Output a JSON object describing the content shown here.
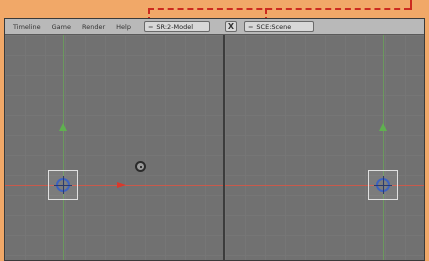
{
  "menubar": {
    "items": [
      "Timeline",
      "Game",
      "Render",
      "Help"
    ],
    "screen_prefix": "=",
    "screen_name": "SR:2-Model",
    "close_label": "X",
    "scene_prefix": "=",
    "scene_name": "SCE:Scene"
  },
  "icons": {
    "camera": "camera-icon",
    "origin": "object-origin-icon",
    "y_axis_arrow": "y-axis-arrow-icon",
    "x_axis_arrow": "x-axis-arrow-icon",
    "annotation_arrow": "annotation-arrow-icon"
  },
  "colors": {
    "background_border": "#f1a868",
    "viewport": "#717171",
    "x_axis": "#c85a4c",
    "y_axis": "#6aa35a",
    "annotation": "#cc2a1f"
  }
}
